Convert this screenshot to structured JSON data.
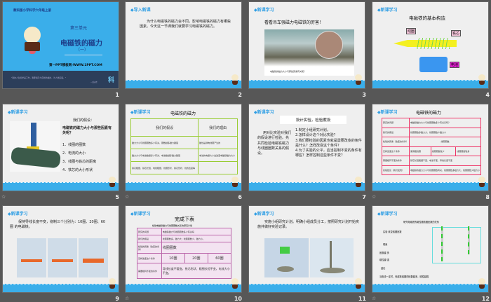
{
  "slides": [
    {
      "number": "1",
      "publisher": "教科版小学科学六年级上册",
      "unit": "第三单元",
      "title": "电磁铁的磁力",
      "subtitle": "（一）",
      "site": "第一PPT模板网-WWW.1PPT.COM",
      "quote": "\"我的人生哲学是工作，我要揭示大自然的奥妙，为人类造福。\"",
      "quote_author": "—爱迪生",
      "badge": "科"
    },
    {
      "number": "2",
      "tag": "◆导入新课",
      "body": "为什么电磁铁的磁力会不同，影响电磁铁的磁力有哪些因素。今天这一节课我们就要学习电磁铁的磁力。"
    },
    {
      "number": "3",
      "tag": "◆新课学习",
      "title": "看看吊车强磁力电磁铁的厉害！",
      "caption": "电磁铁的磁力大小与那些因素有关呢？"
    },
    {
      "number": "4",
      "tag": "◆新课学习",
      "title": "电磁铁的基本构造",
      "labels": [
        "线圈",
        "铁芯",
        "电池"
      ]
    },
    {
      "number": "5",
      "tag": "◆新课学习",
      "heading": "我们的假设：",
      "question": "电磁铁的磁力大小与那些因素有关呢？",
      "items": [
        "1．线圈的圈数",
        "2．电流的大小",
        "3．线圈与铁芯的距离",
        "4．铁芯的大小形状"
      ]
    },
    {
      "number": "6",
      "tag": "◆新课学习",
      "title": "电磁铁的磁力",
      "headers": [
        "我们的假设",
        "我们的理由"
      ],
      "rows": [
        [
          "磁力大小与线圈圈数多少有关，圈数越多磁力越强",
          "磁性是通电线圈产生的"
        ],
        [
          "磁力大小与电池数量多少有关，电池数越多磁力越强",
          "电池的电量大小会改变电磁铁磁力大小"
        ],
        [
          "铁芯粗细、铁芯长短、电线粗细、线圈形状、铁芯形状、线的宽度等",
          ""
        ]
      ]
    },
    {
      "number": "7",
      "tag": "◆新课学习",
      "title": "设计实验，检验假设",
      "left": "用对比实验对我们的假设进行检验。先共同检验电磁铁磁力与线圈圈数关系的假设。",
      "steps": [
        "1.制定小组研究计划。",
        "2.怎样设计这个对比实验？",
        "3.我们要检验的因素也就是需要改变的条件是什么？怎样改变这个条件？",
        "4.为了实验的公平，应当控制不变的条件有哪些？怎样控制这些条件不变？"
      ]
    },
    {
      "number": "8",
      "tag": "◆新课学习",
      "title": "电磁铁的磁力",
      "rows": [
        [
          "研究的问题",
          "电磁铁磁力大小与线圈圈数多少有关系吗？"
        ],
        [
          "我们的假设",
          "线圈圈数多磁力大，线圈圈数少磁力小"
        ],
        [
          "检验的因素（改变的条件）",
          "线圈圈数"
        ],
        [
          "怎样改变这个条件",
          "使用粗线圈",
          "线圈圈数较少",
          "线圈圈数较多"
        ],
        [
          "需要相同不变的条件",
          "铁芯长短粗细不变、电池不变、导线长度不变"
        ],
        [
          "实验结论（我们发现）",
          "电磁铁的磁力大小与线圈圈数有关，线圈圈数多磁力大，线圈圈数少磁力小"
        ]
      ]
    },
    {
      "number": "9",
      "tag": "◆新课学习",
      "body": "保持导线长度不变，绕制三个分别为：10圈、20圈、60圈 的电磁铁。"
    },
    {
      "number": "10",
      "tag": "◆新课学习",
      "title": "完成下表",
      "table_title": "检验电磁铁磁力与线圈圈数关系的研究计划",
      "rows": [
        [
          "研究的问题",
          "电磁铁磁力与线圈圈数多少有关吗"
        ],
        [
          "我们的假设",
          "线圈圈数多，磁力大；线圈圈数少，磁力小。"
        ],
        [
          "检验的因素（改变的条件）",
          "线圈圈数"
        ],
        [
          "怎样改变这个条件",
          "10圈",
          "20圈",
          "60圈"
        ],
        [
          "需要相同不变的条件",
          "导线长度不要变，铁芯形状、粗细长短不变，电流大小不变。"
        ]
      ]
    },
    {
      "number": "11",
      "tag": "◆新课学习",
      "body": "实施小组研究计划。明确小组成员分工，按照研究计划开始实施并做好实验记录。"
    },
    {
      "number": "12",
      "tag": "◆新课学习",
      "title": "研究电磁铁的磁性跟线圈匝数的关系",
      "lines": [
        "实验  改变线圈匝数",
        "现象",
        "匝数越 多",
        "磁性越 强",
        "结论",
        "当电流一定时，电磁铁线圈的匝数越多，磁性越强"
      ]
    }
  ],
  "colors": {
    "accent": "#3aaeea",
    "title_slide_bg": "#3aaeea",
    "footer_dark": "#2c3e5a"
  }
}
